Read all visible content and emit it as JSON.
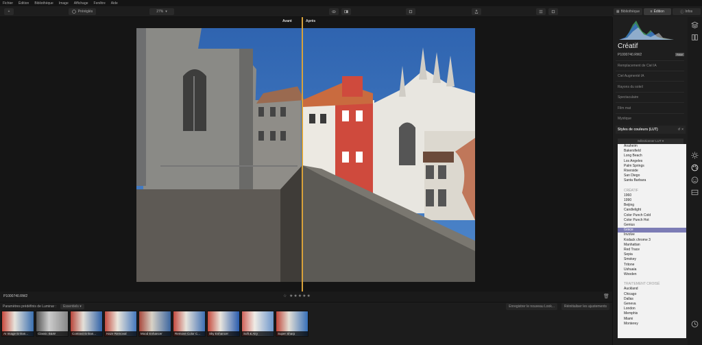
{
  "menu": [
    "Fichier",
    "Édition",
    "Bibliothèque",
    "Image",
    "Affichage",
    "Fenêtre",
    "Aide"
  ],
  "toolbar": {
    "presets_label": "Préréglés",
    "zoom_label": "27%"
  },
  "panel_tabs": [
    "Bibliothèque",
    "Édition",
    "Infos"
  ],
  "compare": {
    "before": "Avant",
    "after": "Après"
  },
  "photo": {
    "filename": "P1000740.RW2",
    "rating_text": "☆ ★★★★★"
  },
  "panel": {
    "title": "Créatif",
    "filename": "P1000740.RW2",
    "raw_badge": "RAW",
    "sections": [
      "Remplacement de Ciel IA",
      "Ciel Augmenté IA",
      "Rayons du soleil",
      "Spectaculaire",
      "Film mat",
      "Mystique"
    ],
    "lut_header": "Styles de couleurs (LUT)",
    "lut_select": "Sélectionner LUT ▾",
    "lut_items": [
      {
        "label": "Anaheim",
        "type": "item"
      },
      {
        "label": "Bakersfield",
        "type": "item"
      },
      {
        "label": "Long Beach",
        "type": "item"
      },
      {
        "label": "Los Angeles",
        "type": "item"
      },
      {
        "label": "Palm Springs",
        "type": "item"
      },
      {
        "label": "Riverside",
        "type": "item"
      },
      {
        "label": "San Diego",
        "type": "item"
      },
      {
        "label": "Santa Barbara",
        "type": "item"
      },
      {
        "label": "",
        "type": "spacer"
      },
      {
        "label": "CRÉATIF",
        "type": "group"
      },
      {
        "label": "1960",
        "type": "item"
      },
      {
        "label": "1990",
        "type": "item"
      },
      {
        "label": "Beijing",
        "type": "item"
      },
      {
        "label": "Candlelight",
        "type": "item"
      },
      {
        "label": "Color Punch Cold",
        "type": "item"
      },
      {
        "label": "Color Punch Hot",
        "type": "item"
      },
      {
        "label": "Genius",
        "type": "item"
      },
      {
        "label": "Grace",
        "type": "selected"
      },
      {
        "label": "Involve",
        "type": "item"
      },
      {
        "label": "Kodack chrome 3",
        "type": "item"
      },
      {
        "label": "Manhattan",
        "type": "item"
      },
      {
        "label": "Red Trace",
        "type": "item"
      },
      {
        "label": "Sepia",
        "type": "item"
      },
      {
        "label": "Smokey",
        "type": "item"
      },
      {
        "label": "Tritone",
        "type": "item"
      },
      {
        "label": "Ushuaia",
        "type": "item"
      },
      {
        "label": "Wooden",
        "type": "item"
      },
      {
        "label": "",
        "type": "spacer"
      },
      {
        "label": "TRAITEMENT CROISÉ",
        "type": "group"
      },
      {
        "label": "Auckland",
        "type": "item"
      },
      {
        "label": "Chicago",
        "type": "item"
      },
      {
        "label": "Dallas",
        "type": "item"
      },
      {
        "label": "Geneva",
        "type": "item"
      },
      {
        "label": "London",
        "type": "item"
      },
      {
        "label": "Memphis",
        "type": "item"
      },
      {
        "label": "Miami",
        "type": "item"
      },
      {
        "label": "Monterey",
        "type": "item"
      }
    ]
  },
  "presets": {
    "header": "Paramètres prédéfinis de Luminar :",
    "filter": "Essentiels",
    "save_btn": "Enregistrer le nouveau Look...",
    "reset_btn": "Réinitialiser les ajustements",
    "items": [
      "AI Image Enhan...",
      "Classic B&W",
      "Contrast Enhan...",
      "Haze Removal",
      "Mood Enhancer",
      "Remove Color C...",
      "Sky Enhancer",
      "Soft & Airy",
      "Super Sharp"
    ]
  }
}
